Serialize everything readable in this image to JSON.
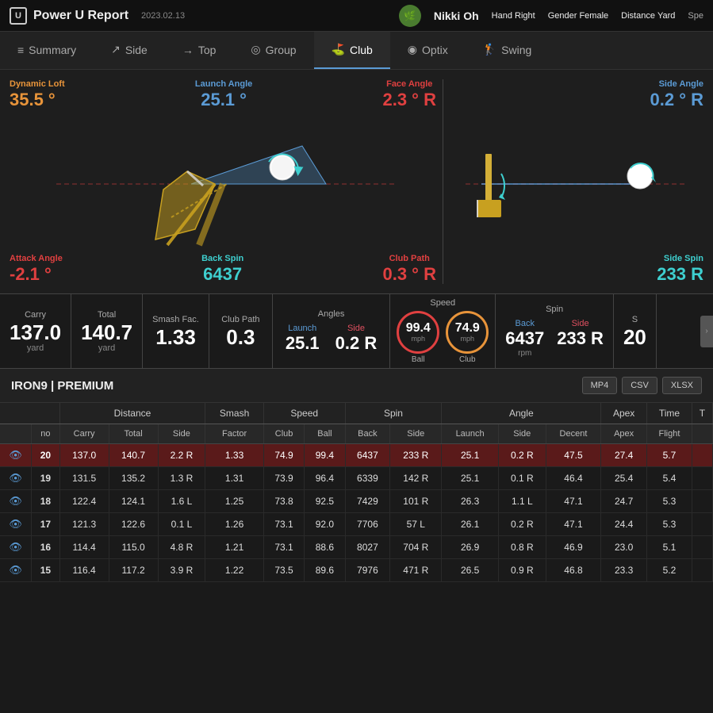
{
  "header": {
    "logo_text": "U",
    "app_title": "Power U Report",
    "app_date": "2023.02.13",
    "user_name": "Nikki Oh",
    "hand_label": "Hand",
    "hand_value": "Right",
    "gender_label": "Gender",
    "gender_value": "Female",
    "distance_label": "Distance",
    "distance_value": "Yard",
    "speed_label": "Spe"
  },
  "nav": {
    "items": [
      {
        "id": "summary",
        "label": "Summary",
        "icon": "≡",
        "active": false
      },
      {
        "id": "side",
        "label": "Side",
        "icon": "↗",
        "active": false
      },
      {
        "id": "top",
        "label": "Top",
        "icon": "→",
        "active": false
      },
      {
        "id": "group",
        "label": "Group",
        "icon": "◎",
        "active": false
      },
      {
        "id": "club",
        "label": "Club",
        "icon": "⛳",
        "active": true
      },
      {
        "id": "optix",
        "label": "Optix",
        "icon": "◉",
        "active": false
      },
      {
        "id": "swing",
        "label": "Swing",
        "icon": "🏌",
        "active": false
      }
    ]
  },
  "metrics_left": {
    "dynamic_loft_label": "Dynamic Loft",
    "dynamic_loft_value": "35.5 °",
    "launch_angle_label": "Launch Angle",
    "launch_angle_value": "25.1 °",
    "face_angle_label": "Face Angle",
    "face_angle_value": "2.3 ° R",
    "attack_angle_label": "Attack Angle",
    "attack_angle_value": "-2.1 °",
    "back_spin_label": "Back Spin",
    "back_spin_value": "6437"
  },
  "metrics_right": {
    "side_angle_label": "Side Angle",
    "side_angle_value": "0.2 ° R",
    "club_path_label": "Club Path",
    "club_path_value": "0.3 ° R",
    "side_spin_label": "Side Spin",
    "side_spin_value": "233 R"
  },
  "stats_bar": {
    "carry_label": "Carry",
    "carry_value": "137.0",
    "carry_unit": "yard",
    "total_label": "Total",
    "total_value": "140.7",
    "total_unit": "yard",
    "smash_label": "Smash Fac.",
    "smash_value": "1.33",
    "club_path_label": "Club Path",
    "club_path_value": "0.3",
    "angles_label": "Angles",
    "launch_label": "Launch",
    "launch_value": "25.1",
    "side_label": "Side",
    "side_value": "0.2 R",
    "speed_label": "Speed",
    "ball_label": "Ball",
    "ball_value": "99.4",
    "ball_unit": "mph",
    "club_label": "Club",
    "club_value": "74.9",
    "club_unit": "mph",
    "spin_label": "Spin",
    "back_label": "Back",
    "back_value": "6437",
    "back_unit": "rpm",
    "side_spin_label": "Side",
    "side_spin_value": "233 R",
    "extra_label": "S",
    "extra_value": "20"
  },
  "table": {
    "club_label": "IRON9 | PREMIUM",
    "export_mp4": "MP4",
    "export_csv": "CSV",
    "export_xlsx": "XLSX",
    "group_headers": [
      "",
      "",
      "Distance",
      "",
      "Smash",
      "Speed",
      "",
      "Spin",
      "",
      "Angle",
      "",
      "",
      "Apex",
      "Time",
      "T"
    ],
    "sub_headers": [
      "",
      "no",
      "Carry",
      "Total",
      "Side",
      "Factor",
      "Club",
      "Ball",
      "Back",
      "Side",
      "Launch",
      "Side",
      "Decent",
      "Apex",
      "Flight",
      ""
    ],
    "rows": [
      {
        "eye": true,
        "no": "20",
        "carry": "137.0",
        "total": "140.7",
        "side": "2.2 R",
        "factor": "1.33",
        "club": "74.9",
        "ball": "99.4",
        "back": "6437",
        "side_spin": "233 R",
        "launch": "25.1",
        "side_angle": "0.2 R",
        "decent": "47.5",
        "apex": "27.4",
        "flight": "5.7",
        "active": true
      },
      {
        "eye": true,
        "no": "19",
        "carry": "131.5",
        "total": "135.2",
        "side": "1.3 R",
        "factor": "1.31",
        "club": "73.9",
        "ball": "96.4",
        "back": "6339",
        "side_spin": "142 R",
        "launch": "25.1",
        "side_angle": "0.1 R",
        "decent": "46.4",
        "apex": "25.4",
        "flight": "5.4",
        "active": false
      },
      {
        "eye": true,
        "no": "18",
        "carry": "122.4",
        "total": "124.1",
        "side": "1.6 L",
        "factor": "1.25",
        "club": "73.8",
        "ball": "92.5",
        "back": "7429",
        "side_spin": "101 R",
        "launch": "26.3",
        "side_angle": "1.1 L",
        "decent": "47.1",
        "apex": "24.7",
        "flight": "5.3",
        "active": false
      },
      {
        "eye": true,
        "no": "17",
        "carry": "121.3",
        "total": "122.6",
        "side": "0.1 L",
        "factor": "1.26",
        "club": "73.1",
        "ball": "92.0",
        "back": "7706",
        "side_spin": "57 L",
        "launch": "26.1",
        "side_angle": "0.2 R",
        "decent": "47.1",
        "apex": "24.4",
        "flight": "5.3",
        "active": false
      },
      {
        "eye": true,
        "no": "16",
        "carry": "114.4",
        "total": "115.0",
        "side": "4.8 R",
        "factor": "1.21",
        "club": "73.1",
        "ball": "88.6",
        "back": "8027",
        "side_spin": "704 R",
        "launch": "26.9",
        "side_angle": "0.8 R",
        "decent": "46.9",
        "apex": "23.0",
        "flight": "5.1",
        "active": false
      },
      {
        "eye": true,
        "no": "15",
        "carry": "116.4",
        "total": "117.2",
        "side": "3.9 R",
        "factor": "1.22",
        "club": "73.5",
        "ball": "89.6",
        "back": "7976",
        "side_spin": "471 R",
        "launch": "26.5",
        "side_angle": "0.9 R",
        "decent": "46.8",
        "apex": "23.3",
        "flight": "5.2",
        "active": false
      }
    ]
  },
  "colors": {
    "orange": "#e8943a",
    "blue": "#5b9bd5",
    "teal": "#3ecfcf",
    "red": "#e04040",
    "pink_red": "#e05060",
    "active_row": "#5a1a1a"
  }
}
